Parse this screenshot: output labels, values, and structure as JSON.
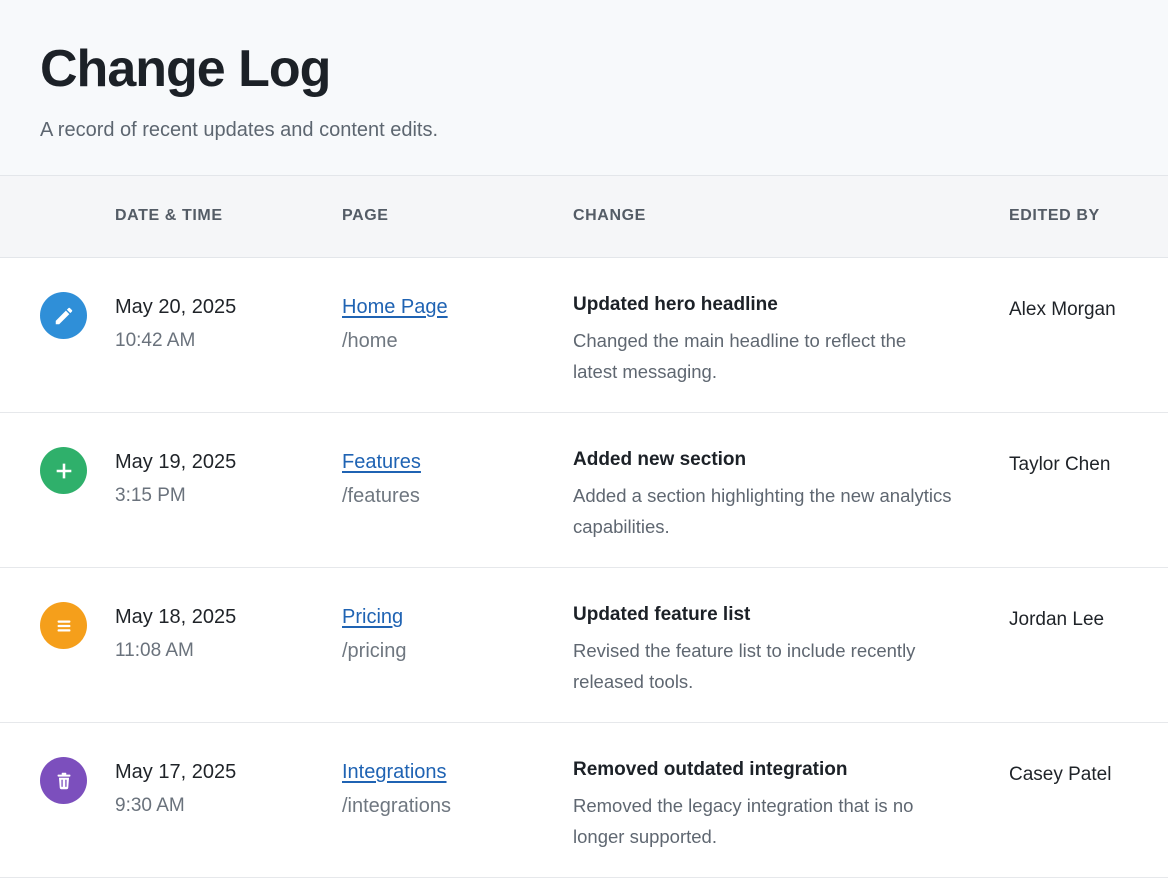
{
  "header": {
    "title": "Change Log",
    "subtitle": "A record of recent updates and content edits."
  },
  "columns": {
    "date": "DATE & TIME",
    "page": "PAGE",
    "change": "CHANGE",
    "editor": "EDITED BY"
  },
  "rows": [
    {
      "icon": "pencil-icon",
      "icon_color": "#2f8fd8",
      "date": "May 20, 2025",
      "time": "10:42 AM",
      "page": "Home Page",
      "path": "/home",
      "change_title": "Updated hero headline",
      "change_desc": "Changed the main headline to reflect the latest messaging.",
      "editor": "Alex Morgan"
    },
    {
      "icon": "plus-icon",
      "icon_color": "#2fb06b",
      "date": "May 19, 2025",
      "time": "3:15 PM",
      "page": "Features",
      "path": "/features",
      "change_title": "Added new section",
      "change_desc": "Added a section highlighting the new analytics capabilities.",
      "editor": "Taylor Chen"
    },
    {
      "icon": "list-icon",
      "icon_color": "#f59f1b",
      "date": "May 18, 2025",
      "time": "11:08 AM",
      "page": "Pricing",
      "path": "/pricing",
      "change_title": "Updated feature list",
      "change_desc": "Revised the feature list to include recently released tools.",
      "editor": "Jordan Lee"
    },
    {
      "icon": "trash-icon",
      "icon_color": "#7c4fbd",
      "date": "May 17, 2025",
      "time": "9:30 AM",
      "page": "Integrations",
      "path": "/integrations",
      "change_title": "Removed outdated integration",
      "change_desc": "Removed the legacy integration that is no longer supported.",
      "editor": "Casey Patel"
    }
  ]
}
